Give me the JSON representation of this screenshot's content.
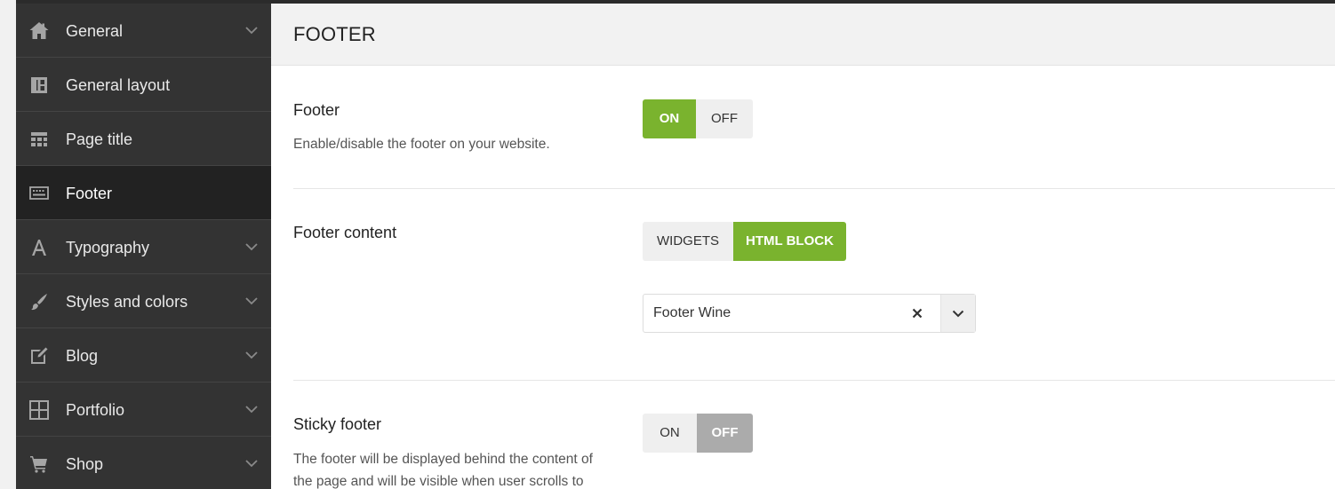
{
  "sidebar": {
    "items": [
      {
        "label": "General",
        "icon": "home-icon",
        "has_submenu": true
      },
      {
        "label": "General layout",
        "icon": "layout-icon",
        "has_submenu": false
      },
      {
        "label": "Page title",
        "icon": "page-title-icon",
        "has_submenu": false
      },
      {
        "label": "Footer",
        "icon": "footer-icon",
        "has_submenu": false,
        "active": true
      },
      {
        "label": "Typography",
        "icon": "typography-icon",
        "has_submenu": true
      },
      {
        "label": "Styles and colors",
        "icon": "brush-icon",
        "has_submenu": true
      },
      {
        "label": "Blog",
        "icon": "edit-icon",
        "has_submenu": true
      },
      {
        "label": "Portfolio",
        "icon": "grid-icon",
        "has_submenu": true
      },
      {
        "label": "Shop",
        "icon": "cart-icon",
        "has_submenu": true
      }
    ]
  },
  "header": {
    "title": "FOOTER"
  },
  "settings": {
    "footer": {
      "label": "Footer",
      "description": "Enable/disable the footer on your website.",
      "options": [
        "ON",
        "OFF"
      ],
      "selected": "ON"
    },
    "footer_content": {
      "label": "Footer content",
      "options": [
        "WIDGETS",
        "HTML BLOCK"
      ],
      "selected": "HTML BLOCK",
      "select_value": "Footer Wine"
    },
    "sticky_footer": {
      "label": "Sticky footer",
      "description_line1": "The footer will be displayed behind the content of",
      "description_line2": "the page and will be visible when user scrolls to",
      "options": [
        "ON",
        "OFF"
      ],
      "selected": "OFF"
    }
  },
  "colors": {
    "sidebar_bg": "#333333",
    "sidebar_active_bg": "#222222",
    "accent_green": "#7ab32e",
    "inactive_grey": "#ababab"
  }
}
